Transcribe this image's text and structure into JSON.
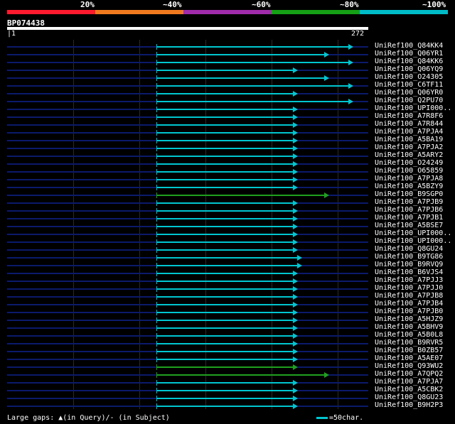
{
  "legend": {
    "labels": [
      "20%",
      "~40%",
      "~60%",
      "~80%",
      "~100%"
    ],
    "colors": [
      "#ff1a2e",
      "#f07a1e",
      "#a02cab",
      "#15a015",
      "#00bcc8"
    ]
  },
  "query": {
    "name": "BP074438",
    "start": "1",
    "end": "272"
  },
  "hits": [
    {
      "name": "UniRef100_Q84KK4",
      "end": 490,
      "color": "#00c6d0"
    },
    {
      "name": "UniRef100_Q06YR1",
      "end": 456,
      "color": "#00c6d0"
    },
    {
      "name": "UniRef100_Q84KK6",
      "end": 490,
      "color": "#00c6d0"
    },
    {
      "name": "UniRef100_Q06YQ9",
      "end": 412,
      "color": "#00c6d0"
    },
    {
      "name": "UniRef100_O24305",
      "end": 456,
      "color": "#00c6d0"
    },
    {
      "name": "UniRef100_C6TF11",
      "end": 490,
      "color": "#00c6d0"
    },
    {
      "name": "UniRef100_Q06YR0",
      "end": 412,
      "color": "#00c6d0"
    },
    {
      "name": "UniRef100_Q2PU70",
      "end": 490,
      "color": "#00c6d0"
    },
    {
      "name": "UniRef100_UPI000..",
      "end": 412,
      "color": "#00c6d0"
    },
    {
      "name": "UniRef100_A7R8F6",
      "end": 412,
      "color": "#00c6d0"
    },
    {
      "name": "UniRef100_A7R844",
      "end": 412,
      "color": "#00c6d0"
    },
    {
      "name": "UniRef100_A7PJA4",
      "end": 412,
      "color": "#00c6d0"
    },
    {
      "name": "UniRef100_A5BA19",
      "end": 412,
      "color": "#00c6d0"
    },
    {
      "name": "UniRef100_A7PJA2",
      "end": 412,
      "color": "#00c6d0"
    },
    {
      "name": "UniRef100_A5ARY2",
      "end": 412,
      "color": "#00c6d0"
    },
    {
      "name": "UniRef100_O24249",
      "end": 412,
      "color": "#00c6d0"
    },
    {
      "name": "UniRef100_O65859",
      "end": 412,
      "color": "#00c6d0"
    },
    {
      "name": "UniRef100_A7PJA8",
      "end": 412,
      "color": "#00c6d0"
    },
    {
      "name": "UniRef100_A5BZY9",
      "end": 412,
      "color": "#00c6d0"
    },
    {
      "name": "UniRef100_B9SGP0",
      "end": 456,
      "color": "#1fa01f"
    },
    {
      "name": "UniRef100_A7PJB9",
      "end": 412,
      "color": "#00c6d0"
    },
    {
      "name": "UniRef100_A7PJB6",
      "end": 412,
      "color": "#00c6d0"
    },
    {
      "name": "UniRef100_A7PJB1",
      "end": 412,
      "color": "#00c6d0"
    },
    {
      "name": "UniRef100_A5BSE7",
      "end": 412,
      "color": "#00c6d0"
    },
    {
      "name": "UniRef100_UPI000..",
      "end": 412,
      "color": "#00c6d0"
    },
    {
      "name": "UniRef100_UPI000..",
      "end": 412,
      "color": "#00c6d0"
    },
    {
      "name": "UniRef100_Q8GU24",
      "end": 412,
      "color": "#00c6d0"
    },
    {
      "name": "UniRef100_B9TG86",
      "end": 418,
      "color": "#00c6d0"
    },
    {
      "name": "UniRef100_B9RVQ9",
      "end": 418,
      "color": "#00c6d0"
    },
    {
      "name": "UniRef100_B6VJS4",
      "end": 412,
      "color": "#00c6d0"
    },
    {
      "name": "UniRef100_A7PJJ3",
      "end": 412,
      "color": "#00c6d0"
    },
    {
      "name": "UniRef100_A7PJJ0",
      "end": 412,
      "color": "#00c6d0"
    },
    {
      "name": "UniRef100_A7PJB8",
      "end": 412,
      "color": "#00c6d0"
    },
    {
      "name": "UniRef100_A7PJB4",
      "end": 412,
      "color": "#00c6d0"
    },
    {
      "name": "UniRef100_A7PJB0",
      "end": 412,
      "color": "#00c6d0"
    },
    {
      "name": "UniRef100_A5HJZ9",
      "end": 412,
      "color": "#00c6d0"
    },
    {
      "name": "UniRef100_A5BHV9",
      "end": 412,
      "color": "#00c6d0"
    },
    {
      "name": "UniRef100_A5B0L8",
      "end": 412,
      "color": "#00c6d0"
    },
    {
      "name": "UniRef100_B9RVR5",
      "end": 412,
      "color": "#00c6d0"
    },
    {
      "name": "UniRef100_B0ZB57",
      "end": 412,
      "color": "#00c6d0"
    },
    {
      "name": "UniRef100_A5AE07",
      "end": 412,
      "color": "#00c6d0"
    },
    {
      "name": "UniRef100_Q93WU2",
      "end": 412,
      "color": "#1fa01f"
    },
    {
      "name": "UniRef100_A7QPQ2",
      "end": 456,
      "color": "#1fa01f"
    },
    {
      "name": "UniRef100_A7PJA7",
      "end": 412,
      "color": "#00c6d0"
    },
    {
      "name": "UniRef100_A5CBK2",
      "end": 412,
      "color": "#00c6d0"
    },
    {
      "name": "UniRef100_Q8GU23",
      "end": 412,
      "color": "#00c6d0"
    },
    {
      "name": "UniRef100_B9H2P3",
      "end": 412,
      "color": "#00c6d0"
    }
  ],
  "footer": {
    "large_gaps": "Large gaps: ▲(in Query)/- (in Subject)",
    "scale_note": "=50char."
  }
}
